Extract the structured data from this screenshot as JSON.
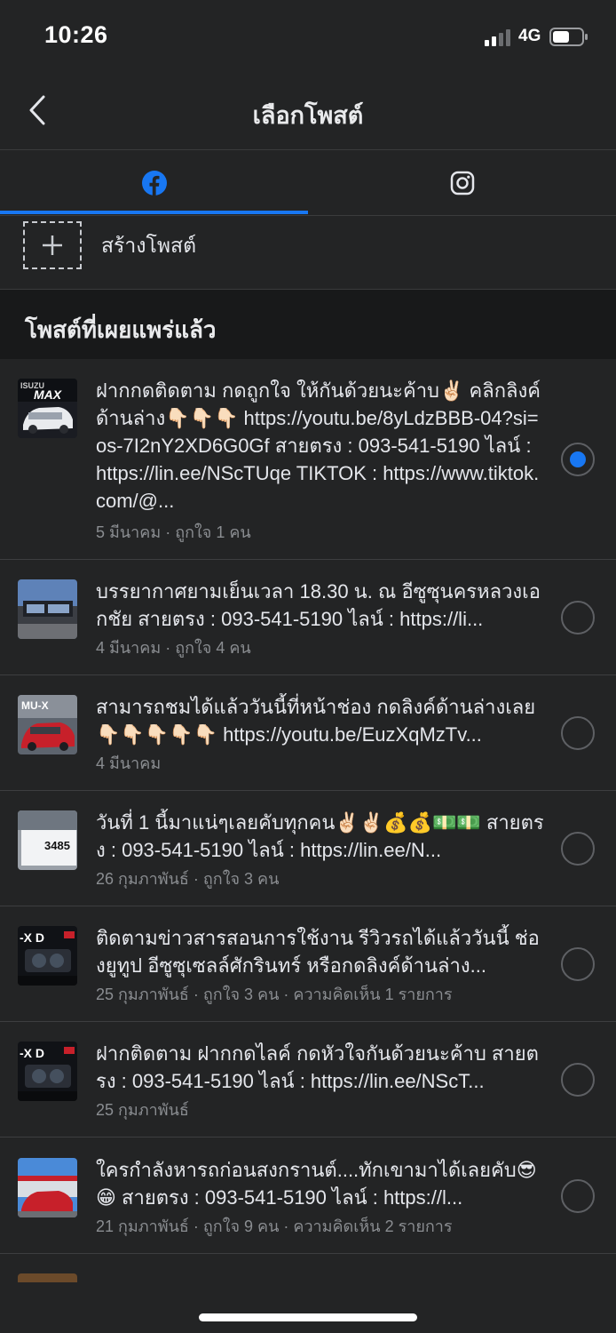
{
  "status_bar": {
    "time": "10:26",
    "network": "4G"
  },
  "nav": {
    "title": "เลือกโพสต์"
  },
  "tabs": [
    {
      "name": "facebook",
      "selected": true
    },
    {
      "name": "instagram",
      "selected": false
    }
  ],
  "create": {
    "label": "สร้างโพสต์"
  },
  "section": {
    "title": "โพสต์ที่เผยแพร่แล้ว"
  },
  "posts": [
    {
      "text": "ฝากกดติดตาม กดถูกใจ ให้กันด้วยนะค้าบ✌🏻  คลิกลิงค์ด้านล่าง👇🏻👇🏻👇🏻 https://youtu.be/8yLdzBBB-04?si=os-7I2nY2XD6G0Gf  สายตรง : 093-541-5190 ไลน์ : https://lin.ee/NScTUqe TIKTOK : https://www.tiktok.com/@...",
      "meta": "5 มีนาคม · ถูกใจ 1 คน",
      "selected": true
    },
    {
      "text": "บรรยากาศยามเย็นเวลา 18.30 น. ณ อีซูซุนครหลวงเอกชัย  สายตรง : 093-541-5190 ไลน์ : https://li...",
      "meta": "4 มีนาคม · ถูกใจ 4 คน",
      "selected": false
    },
    {
      "text": "สามารถชมได้แล้ววันนี้ที่หน้าช่อง  กดลิงค์ด้านล่างเลย👇🏻👇🏻👇🏻👇🏻👇🏻 https://youtu.be/EuzXqMzTv...",
      "meta": "4 มีนาคม",
      "selected": false
    },
    {
      "text": "วันที่ 1 นี้มาแน่ๆเลยคับทุกคน✌🏻✌🏻💰💰💵💵 สายตรง : 093-541-5190 ไลน์ : https://lin.ee/N...",
      "meta": "26 กุมภาพันธ์ · ถูกใจ 3 คน",
      "selected": false
    },
    {
      "text": "ติดตามข่าวสารสอนการใช้งาน รีวิวรถได้แล้ววันนี้ ช่องยูทูป อีซูซุเซลล์ศักรินทร์  หรือกดลิงค์ด้านล่าง...",
      "meta": "25 กุมภาพันธ์ · ถูกใจ 3 คน · ความคิดเห็น 1 รายการ",
      "selected": false
    },
    {
      "text": "ฝากติดตาม ฝากกดไลค์ กดหัวใจกันด้วยนะค้าบ  สายตรง : 093-541-5190 ไลน์ : https://lin.ee/NScT...",
      "meta": "25 กุมภาพันธ์",
      "selected": false
    },
    {
      "text": "ใครกำลังหารถก่อนสงกรานต์....ทักเขามาได้เลยคับ😎😁  สายตรง : 093-541-5190 ไลน์ : https://l...",
      "meta": "21 กุมภาพันธ์ · ถูกใจ 9 คน · ความคิดเห็น 2 รายการ",
      "selected": false
    }
  ],
  "colors": {
    "background": "#232425",
    "accent": "#1877f2",
    "section_bg": "#18191a",
    "meta_text": "#8a8d91"
  },
  "icons": [
    "back-chevron-icon",
    "facebook-icon",
    "instagram-icon",
    "plus-icon",
    "radio-icon"
  ]
}
